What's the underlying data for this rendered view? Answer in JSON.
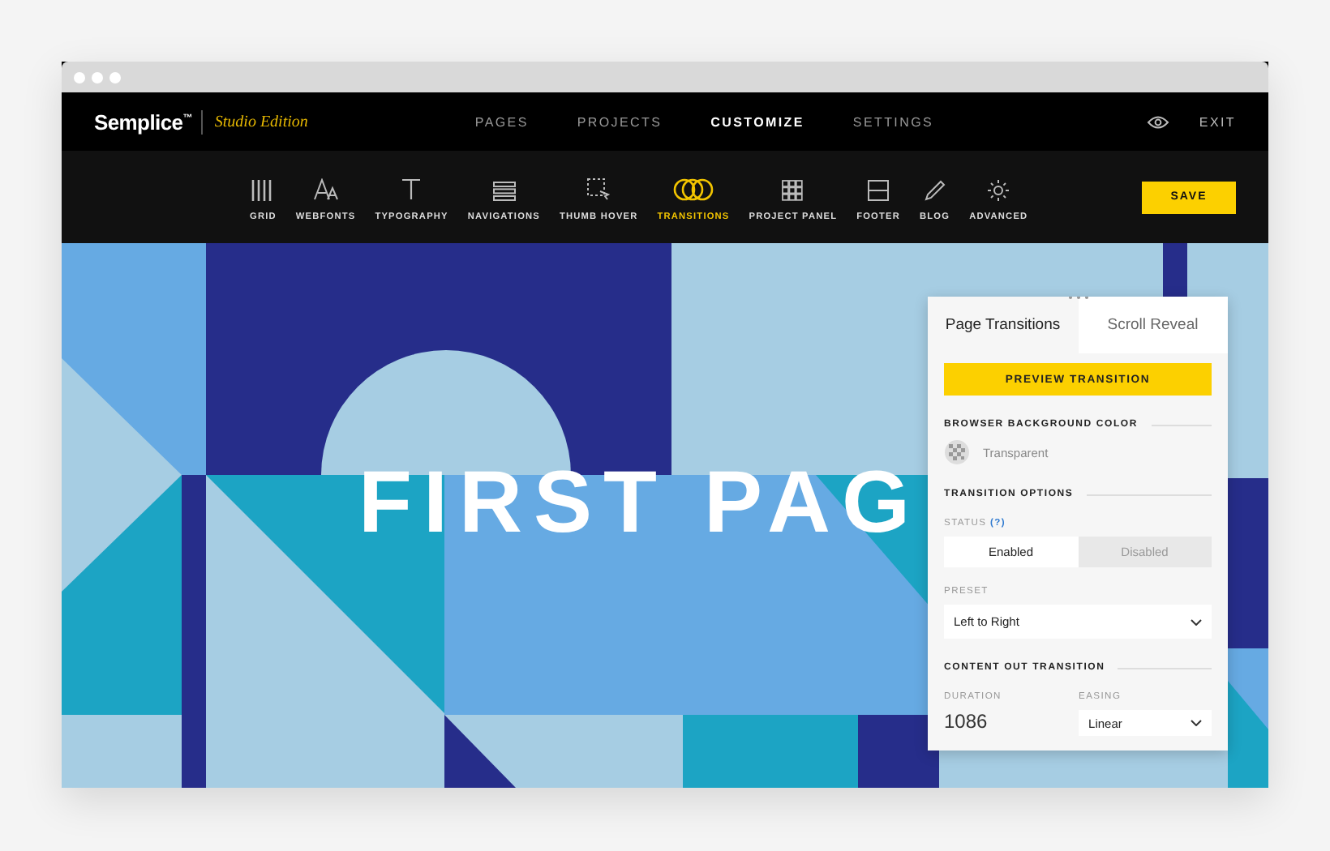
{
  "header": {
    "logo": "Semplice",
    "logo_mark": "™",
    "edition": "Studio Edition",
    "nav": [
      {
        "label": "PAGES",
        "selected": false
      },
      {
        "label": "PROJECTS",
        "selected": false
      },
      {
        "label": "CUSTOMIZE",
        "selected": true
      },
      {
        "label": "SETTINGS",
        "selected": false
      }
    ],
    "exit": "EXIT"
  },
  "toolbar": {
    "tools": [
      {
        "label": "GRID",
        "kind": "grid",
        "selected": false
      },
      {
        "label": "WEBFONTS",
        "kind": "webfonts",
        "selected": false
      },
      {
        "label": "TYPOGRAPHY",
        "kind": "typography",
        "selected": false
      },
      {
        "label": "NAVIGATIONS",
        "kind": "navigations",
        "selected": false
      },
      {
        "label": "THUMB HOVER",
        "kind": "thumb",
        "selected": false
      },
      {
        "label": "TRANSITIONS",
        "kind": "transitions",
        "selected": true
      },
      {
        "label": "PROJECT PANEL",
        "kind": "panel",
        "selected": false
      },
      {
        "label": "FOOTER",
        "kind": "footer",
        "selected": false
      },
      {
        "label": "BLOG",
        "kind": "blog",
        "selected": false
      },
      {
        "label": "ADVANCED",
        "kind": "advanced",
        "selected": false
      }
    ],
    "save": "SAVE"
  },
  "canvas": {
    "headline": "FIRST PAG"
  },
  "panel": {
    "tabs": [
      {
        "label": "Page Transitions",
        "selected": true
      },
      {
        "label": "Scroll Reveal",
        "selected": false
      }
    ],
    "preview_button": "PREVIEW TRANSITION",
    "background_title": "BROWSER BACKGROUND COLOR",
    "background_value": "Transparent",
    "options_title": "TRANSITION OPTIONS",
    "status_label": "STATUS",
    "status_help": "(?)",
    "status_options": [
      {
        "label": "Enabled",
        "selected": true
      },
      {
        "label": "Disabled",
        "selected": false
      }
    ],
    "preset_label": "PRESET",
    "preset_value": "Left to Right",
    "out_title": "CONTENT OUT TRANSITION",
    "duration_label": "DURATION",
    "duration_value": "1086",
    "easing_label": "EASING",
    "easing_value": "Linear"
  }
}
